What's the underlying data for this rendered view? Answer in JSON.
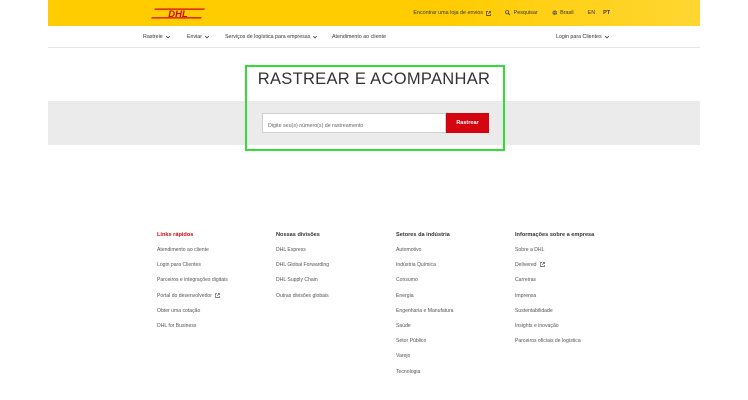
{
  "colors": {
    "brand_yellow": "#ffcc00",
    "brand_red": "#d40511",
    "highlight_green": "#33dd33"
  },
  "brand": {
    "logo_text": "DHL"
  },
  "top_links": {
    "find_store": "Encontrar uma loja de envios",
    "search": "Pesquisar",
    "country": "Brasil",
    "lang_en": "EN",
    "lang_pt": "PT"
  },
  "nav": {
    "rastreie": "Rastreie",
    "enviar": "Enviar",
    "servicos": "Serviços de logística para empresas",
    "atendimento": "Atendimento ao cliente",
    "login": "Login para Clientes"
  },
  "tracking": {
    "title": "RASTREAR E ACOMPANHAR",
    "placeholder": "Digite seu(s) número(s) de rastreamento",
    "button": "Rastrear"
  },
  "footer": {
    "quick_links": {
      "title": "Links rápidos",
      "items": [
        "Atendimento ao cliente",
        "Login para Clientes",
        "Parceiros e integrações digitais",
        "Portal do desenvolvedor",
        "Obter uma cotação",
        "DHL for Business"
      ]
    },
    "divisions": {
      "title": "Nossas divisões",
      "items": [
        "DHL Express",
        "DHL Global Forwarding",
        "DHL Supply Chain",
        "Outras divisões globais"
      ]
    },
    "industry": {
      "title": "Setores da indústria",
      "items": [
        "Automotivo",
        "Indústria Química",
        "Consumo",
        "Energia",
        "Engenharia e Manufatura",
        "Saúde",
        "Setor Público",
        "Varejo",
        "Tecnologia"
      ]
    },
    "company": {
      "title": "Informações sobre a empresa",
      "items": [
        "Sobre a DHL",
        "Delivered",
        "Carreiras",
        "Imprensa",
        "Sustentabilidade",
        "Insights e inovação",
        "Parceiros oficiais de logística"
      ]
    }
  }
}
